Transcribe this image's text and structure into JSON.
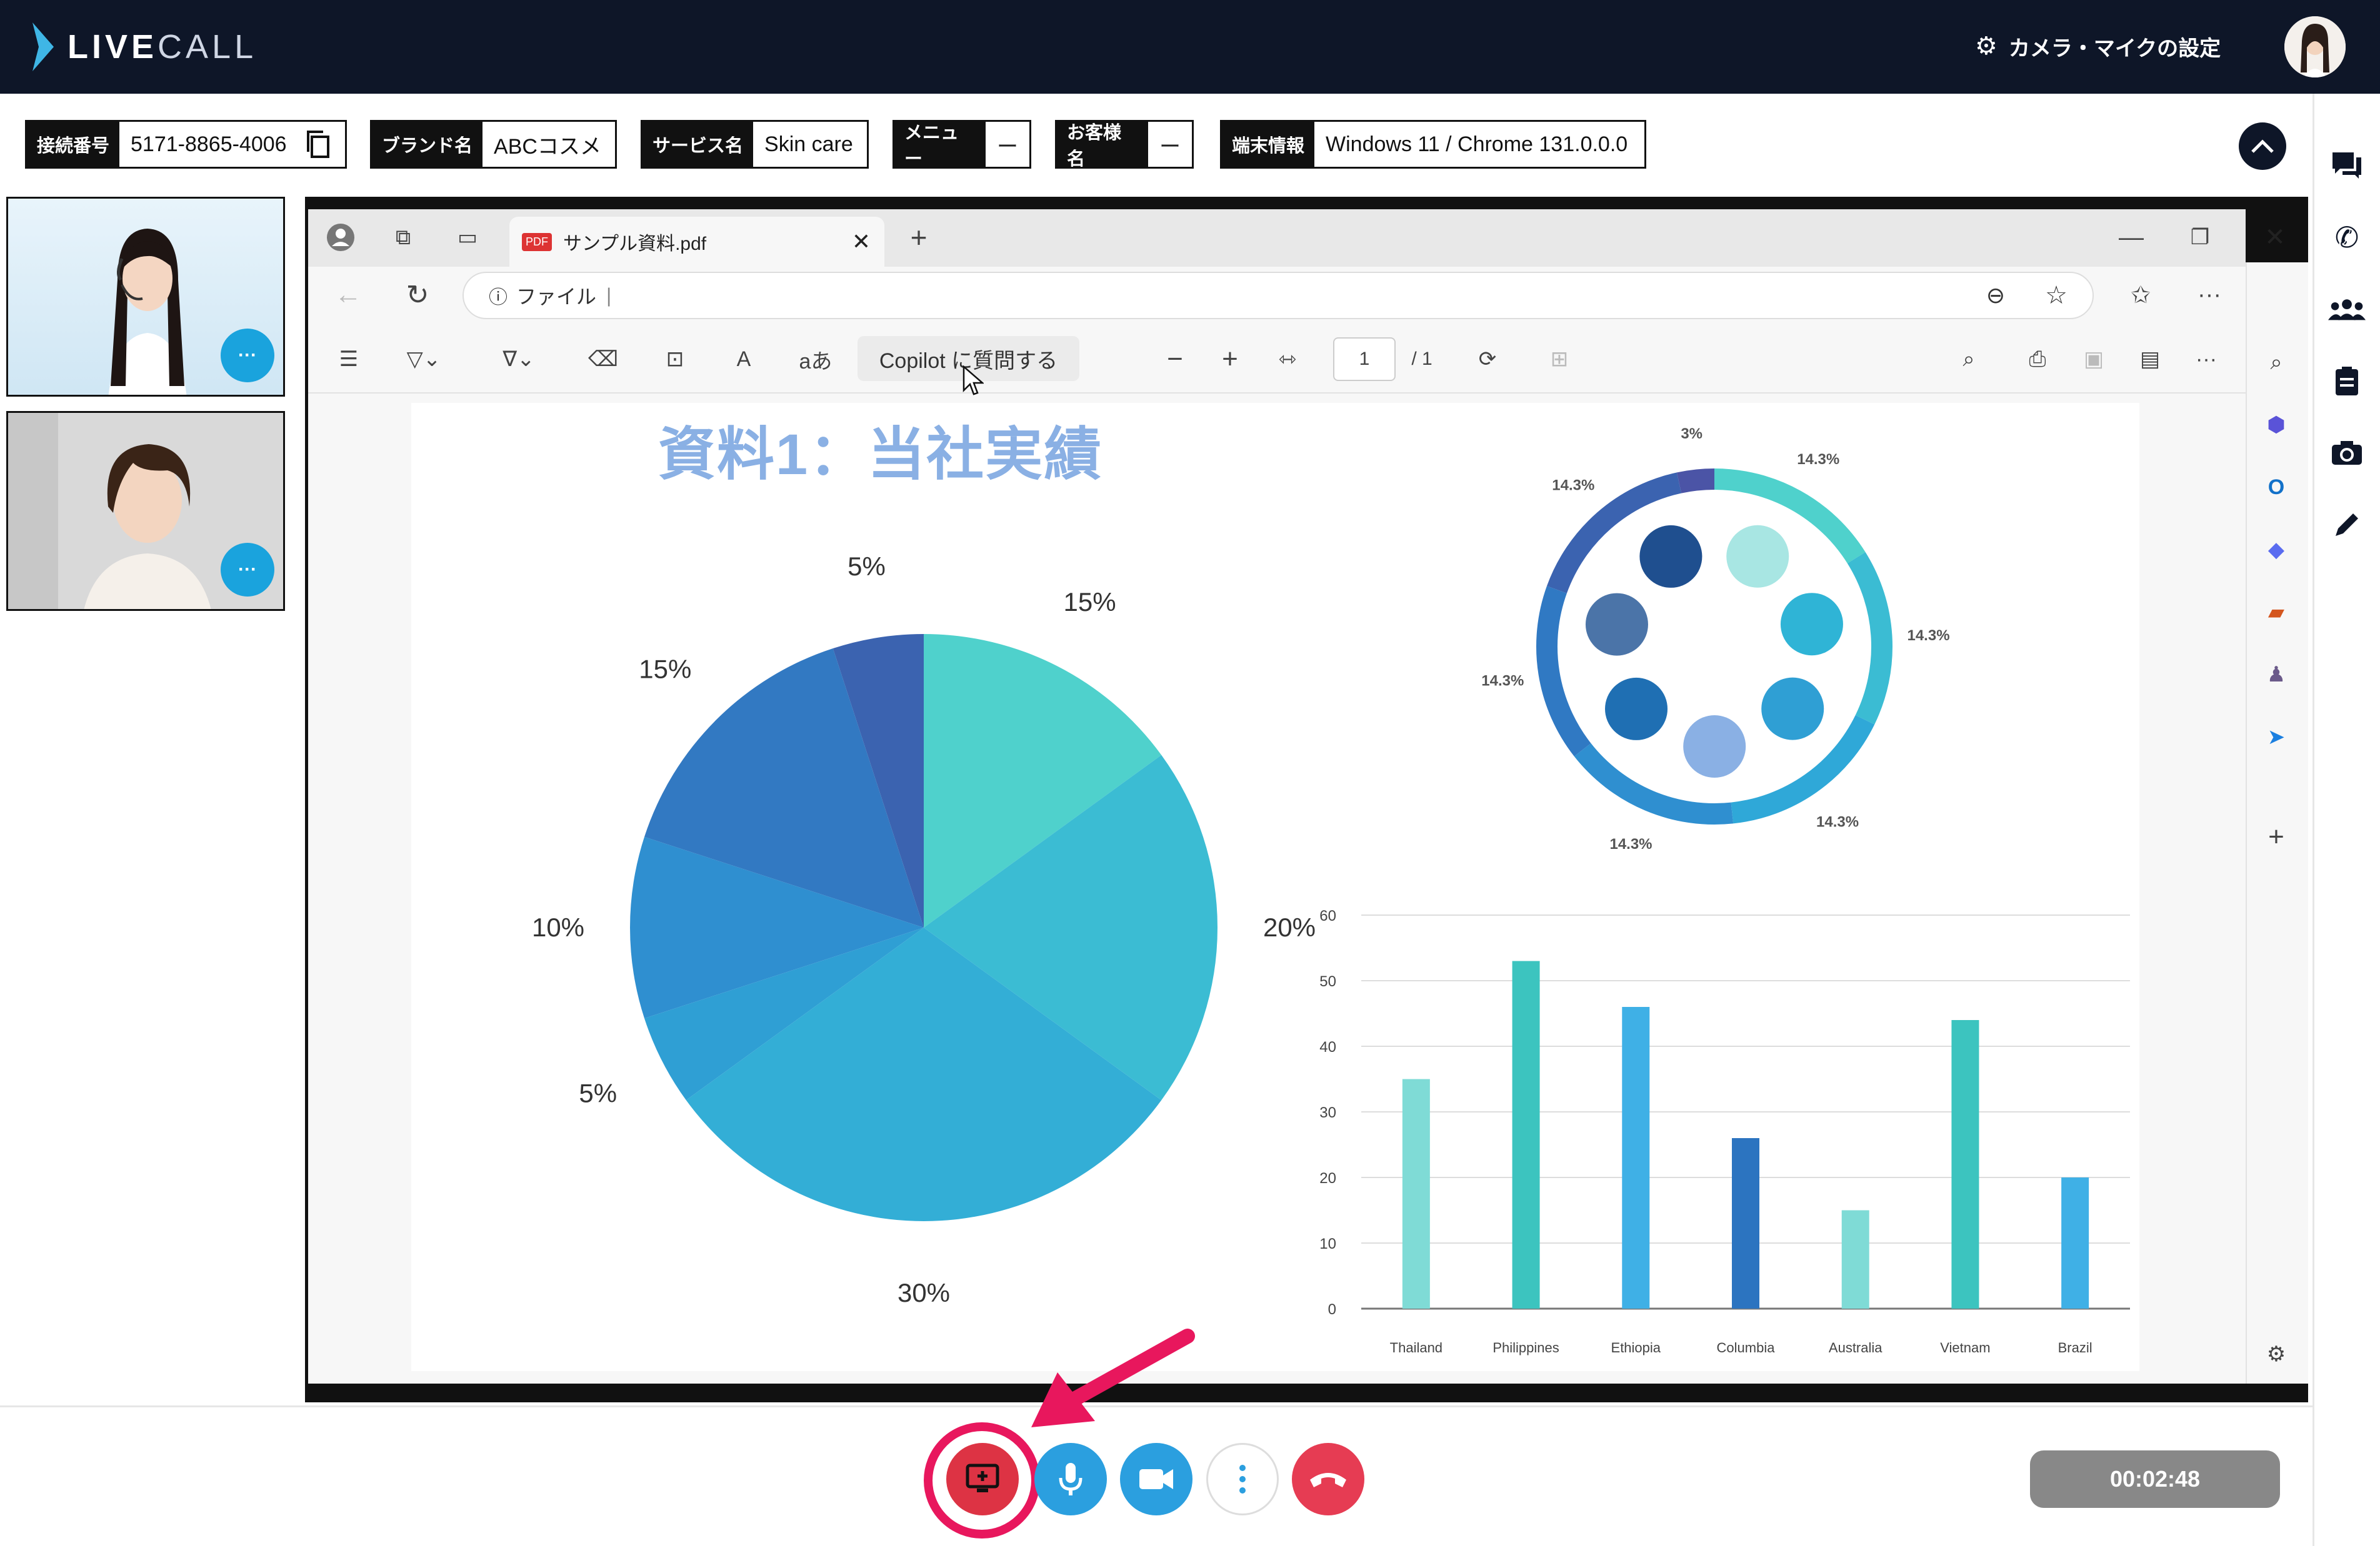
{
  "app": {
    "logo_a": "LIVE",
    "logo_b": "CALL",
    "camera_mic_settings": "カメラ・マイクの設定"
  },
  "infobar": {
    "connection_label": "接続番号",
    "connection_value": "5171-8865-4006",
    "brand_label": "ブランド名",
    "brand_value": "ABCコスメ",
    "service_label": "サービス名",
    "service_value": "Skin care",
    "menu_label": "メニュー",
    "menu_value": "ー",
    "customer_label": "お客様名",
    "customer_value": "ー",
    "device_label": "端末情報",
    "device_value": "Windows 11 / Chrome 131.0.0.0"
  },
  "browser": {
    "tab_title": "サンプル資料.pdf",
    "address_prefix": "ファイル",
    "copilot_button": "Copilot に質問する",
    "page_current": "1",
    "page_total": "/ 1"
  },
  "slide": {
    "title": "資料1：当社実績"
  },
  "chart_data": [
    {
      "type": "pie",
      "values": [
        15,
        20,
        30,
        5,
        10,
        15,
        5
      ],
      "labels": [
        "15%",
        "20%",
        "30%",
        "5%",
        "10%",
        "15%",
        "5%"
      ],
      "colors": [
        "#4fd1cc",
        "#3bbcd3",
        "#33aed6",
        "#2f9fd4",
        "#2f8fd0",
        "#3279c2",
        "#3b63b0"
      ]
    },
    {
      "type": "donut",
      "values": [
        14.3,
        14.3,
        14.3,
        14.3,
        14.3,
        14.3,
        3
      ],
      "labels": [
        "14.3%",
        "14.3%",
        "14.3%",
        "14.3%",
        "14.3%",
        "14.3%",
        "3%"
      ]
    },
    {
      "type": "bar",
      "categories": [
        "Thailand",
        "Philippines",
        "Ethiopia",
        "Columbia",
        "Australia",
        "Vietnam",
        "Brazil"
      ],
      "values": [
        35,
        53,
        46,
        26,
        15,
        44,
        20
      ],
      "ylim": [
        0,
        60
      ],
      "yticks": [
        0,
        10,
        20,
        30,
        40,
        50,
        60
      ],
      "colors": [
        "#7fdbd6",
        "#3cc4bf",
        "#3fb0e6",
        "#2c74c0",
        "#7fdbd6",
        "#3cc4bf",
        "#3fb0e6"
      ]
    }
  ],
  "timer": "00:02:48"
}
